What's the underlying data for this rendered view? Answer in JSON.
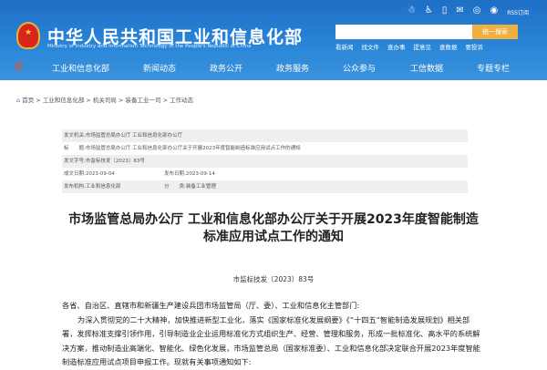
{
  "header": {
    "title": "中华人民共和国工业和信息化部",
    "subtitle": "Ministry of Industry and Information Technology of the People's Republic of China",
    "rss": "RSS订阅",
    "search_placeholder": "",
    "search_button": "统一搜索",
    "quick_links": [
      "看新闻",
      "找文件",
      "查办事",
      "提意见",
      "查数据",
      "要投诉"
    ]
  },
  "nav": [
    "工业和信息化部",
    "新闻动态",
    "政务公开",
    "政务服务",
    "公众参与",
    "工信数据",
    "专题专栏"
  ],
  "breadcrumb": [
    "首页",
    "工业和信息化部",
    "机关司局",
    "装备工业一司",
    "工作动态"
  ],
  "meta": {
    "issuer_label": "发文机关:",
    "issuer": "市场监管总局办公厅 工业和信息化部办公厅",
    "title_label": "标　　题:",
    "title": "市场监管总局办公厅 工业和信息化部办公厅关于开展2023年度智能制造标准应用试点工作的通知",
    "docno_label": "发文字号:",
    "docno": "市监标技发〔2023〕83号",
    "date_label": "成文日期:",
    "date": "2023-09-04",
    "pub_label": "发布日期:",
    "pub": "2023-09-14",
    "org_label": "发布机构:",
    "org": "工业和信息化部",
    "cat_label": "分　　类:",
    "cat": "装备工业管理"
  },
  "doc": {
    "title": "市场监管总局办公厅 工业和信息化部办公厅关于开展2023年度智能制造标准应用试点工作的通知",
    "number": "市监标技发〔2023〕83号",
    "salutation": "各省、自治区、直辖市和新疆生产建设兵团市场监管局（厅、委）、工业和信息化主管部门:",
    "para1": "为深入贯彻党的二十大精神，加快推进新型工业化，落实《国家标准化发展纲要》《“十四五”智能制造发展规划》相关部署，发挥标准支撑引领作用，引导制造业企业运用标准化方式组织生产、经营、管理和服务，形成一批标准化、高水平的系统解决方案，推动制造业高端化、智能化、绿色化发展，市场监管总局（国家标准委）、工业和信息化部决定联合开展2023年度智能制造标准应用试点项目申报工作。现就有关事项通知如下:"
  }
}
